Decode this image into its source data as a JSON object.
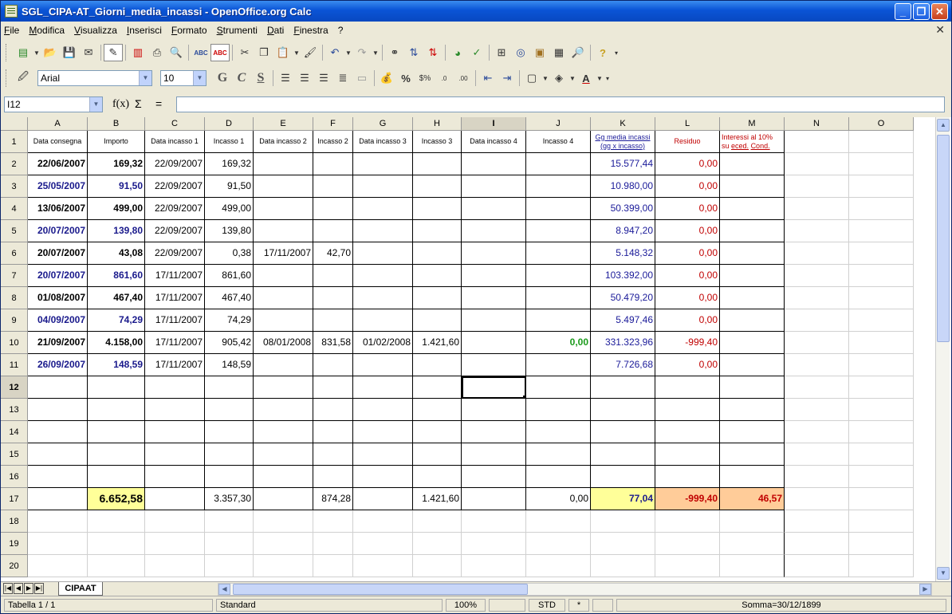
{
  "window": {
    "title": "SGL_CIPA-AT_Giorni_media_incassi - OpenOffice.org Calc",
    "minimize": "_",
    "maximize": "❐",
    "close": "✕"
  },
  "menu": {
    "items": [
      "File",
      "Modifica",
      "Visualizza",
      "Inserisci",
      "Formato",
      "Strumenti",
      "Dati",
      "Finestra",
      "?"
    ],
    "doc_close": "✕"
  },
  "format_toolbar": {
    "font_name": "Arial",
    "font_size": "10",
    "bold": "G",
    "italic": "C",
    "underline": "S"
  },
  "formula_bar": {
    "cell_ref": "I12",
    "fx": "f(x)",
    "sigma": "Σ",
    "equals": "=",
    "content": ""
  },
  "grid": {
    "columns": [
      {
        "label": "A"
      },
      {
        "label": "B"
      },
      {
        "label": "C"
      },
      {
        "label": "D"
      },
      {
        "label": "E"
      },
      {
        "label": "F"
      },
      {
        "label": "G"
      },
      {
        "label": "H"
      },
      {
        "label": "I"
      },
      {
        "label": "J"
      },
      {
        "label": "K"
      },
      {
        "label": "L"
      },
      {
        "label": "M"
      },
      {
        "label": "N"
      },
      {
        "label": "O"
      }
    ],
    "row_numbers": [
      "1",
      "2",
      "3",
      "4",
      "5",
      "6",
      "7",
      "8",
      "9",
      "10",
      "11",
      "12",
      "13",
      "14",
      "15",
      "16",
      "17",
      "18",
      "19",
      "20"
    ],
    "headers": {
      "A": "Data consegna",
      "B": "Importo",
      "C": "Data incasso 1",
      "D": "Incasso 1",
      "E": "Data incasso 2",
      "F": "Incasso 2",
      "G": "Data incasso 3",
      "H": "Incasso 3",
      "I": "Data incasso 4",
      "J": "Incasso 4",
      "K_line1": "Gg media incassi",
      "K_line2": "(gg x incasso)",
      "L": "Residuo",
      "M_line1": "Interessi al 10%",
      "M_line2_prefix": "su ",
      "M_line2_u1": "eced.",
      "M_line2_sp": " ",
      "M_line2_u2": "Cond."
    },
    "data_rows": [
      {
        "A": "22/06/2007",
        "B": "169,32",
        "C": "22/09/2007",
        "D": "169,32",
        "E": "",
        "F": "",
        "G": "",
        "H": "",
        "I": "",
        "J": "",
        "K": "15.577,44",
        "L": "0,00"
      },
      {
        "A": "25/05/2007",
        "B": "91,50",
        "C": "22/09/2007",
        "D": "91,50",
        "E": "",
        "F": "",
        "G": "",
        "H": "",
        "I": "",
        "J": "",
        "K": "10.980,00",
        "L": "0,00"
      },
      {
        "A": "13/06/2007",
        "B": "499,00",
        "C": "22/09/2007",
        "D": "499,00",
        "E": "",
        "F": "",
        "G": "",
        "H": "",
        "I": "",
        "J": "",
        "K": "50.399,00",
        "L": "0,00"
      },
      {
        "A": "20/07/2007",
        "B": "139,80",
        "C": "22/09/2007",
        "D": "139,80",
        "E": "",
        "F": "",
        "G": "",
        "H": "",
        "I": "",
        "J": "",
        "K": "8.947,20",
        "L": "0,00"
      },
      {
        "A": "20/07/2007",
        "B": "43,08",
        "C": "22/09/2007",
        "D": "0,38",
        "E": "17/11/2007",
        "F": "42,70",
        "G": "",
        "H": "",
        "I": "",
        "J": "",
        "K": "5.148,32",
        "L": "0,00"
      },
      {
        "A": "20/07/2007",
        "B": "861,60",
        "C": "17/11/2007",
        "D": "861,60",
        "E": "",
        "F": "",
        "G": "",
        "H": "",
        "I": "",
        "J": "",
        "K": "103.392,00",
        "L": "0,00"
      },
      {
        "A": "01/08/2007",
        "B": "467,40",
        "C": "17/11/2007",
        "D": "467,40",
        "E": "",
        "F": "",
        "G": "",
        "H": "",
        "I": "",
        "J": "",
        "K": "50.479,20",
        "L": "0,00"
      },
      {
        "A": "04/09/2007",
        "B": "74,29",
        "C": "17/11/2007",
        "D": "74,29",
        "E": "",
        "F": "",
        "G": "",
        "H": "",
        "I": "",
        "J": "",
        "K": "5.497,46",
        "L": "0,00"
      },
      {
        "A": "21/09/2007",
        "B": "4.158,00",
        "C": "17/11/2007",
        "D": "905,42",
        "E": "08/01/2008",
        "F": "831,58",
        "G": "01/02/2008",
        "H": "1.421,60",
        "I": "",
        "J": "0,00",
        "K": "331.323,96",
        "L": "-999,40"
      },
      {
        "A": "26/09/2007",
        "B": "148,59",
        "C": "17/11/2007",
        "D": "148,59",
        "E": "",
        "F": "",
        "G": "",
        "H": "",
        "I": "",
        "J": "",
        "K": "7.726,68",
        "L": "0,00"
      }
    ],
    "totals": {
      "B": "6.652,58",
      "D": "3.357,30",
      "F": "874,28",
      "H": "1.421,60",
      "J": "0,00",
      "K": "77,04",
      "L": "-999,40",
      "M": "46,57"
    },
    "colors": {
      "total_yellow": "#ffff99",
      "total_orange": "#ffcc99",
      "text_navy": "#1a1a8c",
      "text_red": "#c00000",
      "text_green": "#1a9a1a"
    }
  },
  "sheet_tab": "CIPAAT",
  "status": {
    "sheet": "Tabella 1 / 1",
    "style": "Standard",
    "zoom": "100%",
    "mode": "STD",
    "modified": "*",
    "sum": "Somma=30/12/1899"
  }
}
